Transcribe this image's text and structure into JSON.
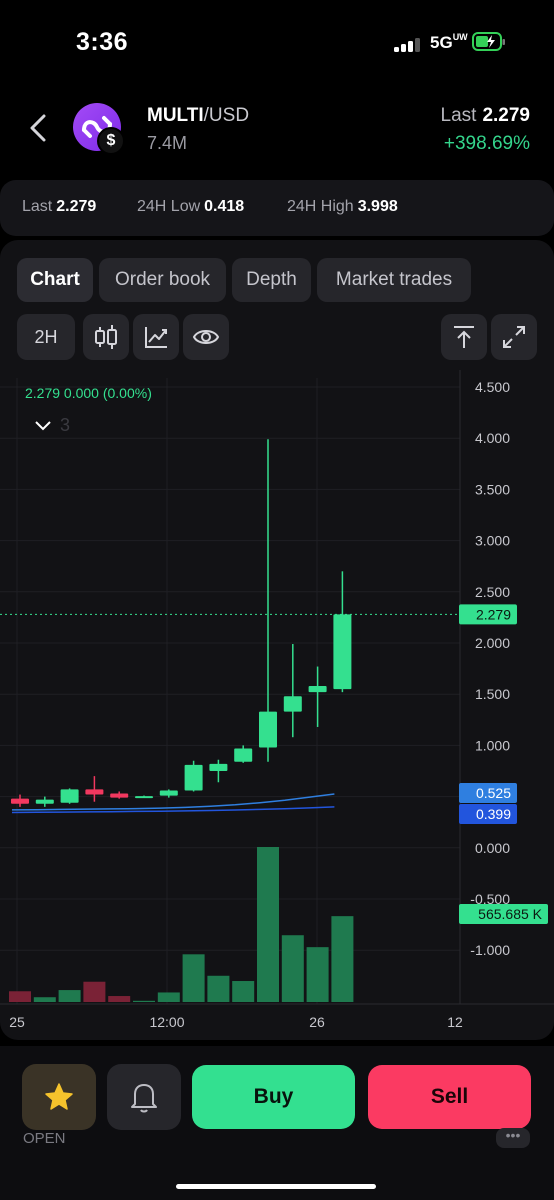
{
  "status_bar": {
    "time": "3:36",
    "network": "5G",
    "network_sub": "UW"
  },
  "header": {
    "pair_base": "MULTI",
    "pair_quote": "/USD",
    "volume": "7.4M",
    "last_label": "Last",
    "last_value": "2.279",
    "change": "+398.69%",
    "badge_symbol": "$"
  },
  "stats": [
    {
      "label": "Last",
      "value": "2.279"
    },
    {
      "label": "24H Low",
      "value": "0.418"
    },
    {
      "label": "24H High",
      "value": "3.998"
    }
  ],
  "tabs": [
    "Chart",
    "Order book",
    "Depth",
    "Market trades"
  ],
  "active_tab": "Chart",
  "toolbar": {
    "interval": "2H"
  },
  "chart_data": {
    "type": "candlestick",
    "info_line": "2.279  0.000 (0.00%)",
    "indicator_count": "3",
    "last_price_tag": "2.279",
    "ma_tags": [
      {
        "value": "0.525",
        "color": "#2f7fe0"
      },
      {
        "value": "0.399",
        "color": "#2255dd"
      }
    ],
    "volume_tag": "565.685 K",
    "y_ticks": [
      "4.500",
      "4.000",
      "3.500",
      "3.000",
      "2.500",
      "2.000",
      "1.500",
      "1.000",
      "0.500",
      "0.000",
      "-0.500",
      "-1.000"
    ],
    "x_ticks": [
      "25",
      "12:00",
      "26",
      "12"
    ],
    "candles": [
      {
        "o": 0.48,
        "h": 0.52,
        "l": 0.4,
        "c": 0.43
      },
      {
        "o": 0.43,
        "h": 0.5,
        "l": 0.4,
        "c": 0.47
      },
      {
        "o": 0.44,
        "h": 0.58,
        "l": 0.43,
        "c": 0.57
      },
      {
        "o": 0.57,
        "h": 0.7,
        "l": 0.45,
        "c": 0.52
      },
      {
        "o": 0.53,
        "h": 0.55,
        "l": 0.48,
        "c": 0.49
      },
      {
        "o": 0.5,
        "h": 0.51,
        "l": 0.49,
        "c": 0.505
      },
      {
        "o": 0.51,
        "h": 0.57,
        "l": 0.49,
        "c": 0.56
      },
      {
        "o": 0.56,
        "h": 0.85,
        "l": 0.55,
        "c": 0.81
      },
      {
        "o": 0.75,
        "h": 0.86,
        "l": 0.64,
        "c": 0.82
      },
      {
        "o": 0.84,
        "h": 1.0,
        "l": 0.83,
        "c": 0.97
      },
      {
        "o": 0.98,
        "h": 3.99,
        "l": 0.84,
        "c": 1.33
      },
      {
        "o": 1.33,
        "h": 1.99,
        "l": 1.08,
        "c": 1.48
      },
      {
        "o": 1.52,
        "h": 1.77,
        "l": 1.18,
        "c": 1.58
      },
      {
        "o": 1.55,
        "h": 2.7,
        "l": 1.52,
        "c": 2.28
      }
    ],
    "ma_fast": [
      0.37,
      0.372,
      0.375,
      0.378,
      0.38,
      0.383,
      0.388,
      0.395,
      0.405,
      0.42,
      0.44,
      0.465,
      0.495,
      0.525
    ],
    "ma_slow": [
      0.345,
      0.347,
      0.349,
      0.351,
      0.353,
      0.355,
      0.357,
      0.36,
      0.364,
      0.369,
      0.375,
      0.382,
      0.39,
      0.399
    ],
    "volumes": [
      0.045,
      0.02,
      0.05,
      0.085,
      0.025,
      0.005,
      0.04,
      0.2,
      0.11,
      0.088,
      0.65,
      0.28,
      0.23,
      0.36
    ],
    "up_color": "#34e08f",
    "down_color": "#f2385f"
  },
  "actions": {
    "buy": "Buy",
    "sell": "Sell",
    "open": "OPEN"
  },
  "colors": {
    "accent_green": "#33e090",
    "accent_red": "#fb3a62",
    "background": "#000000"
  }
}
